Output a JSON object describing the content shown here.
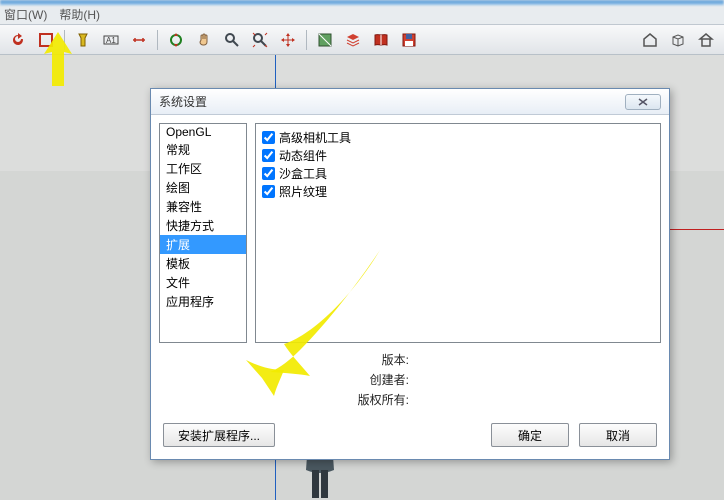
{
  "menubar": {
    "window": "窗口(W)",
    "help": "帮助(H)"
  },
  "dialog": {
    "title": "系统设置",
    "categories": [
      "OpenGL",
      "常规",
      "工作区",
      "绘图",
      "兼容性",
      "快捷方式",
      "扩展",
      "模板",
      "文件",
      "应用程序"
    ],
    "selected_index": 6,
    "extensions": [
      {
        "label": "高级相机工具",
        "checked": true
      },
      {
        "label": "动态组件",
        "checked": true
      },
      {
        "label": "沙盒工具",
        "checked": true
      },
      {
        "label": "照片纹理",
        "checked": true
      }
    ],
    "info_version_label": "版本:",
    "info_author_label": "创建者:",
    "info_copyright_label": "版权所有:",
    "install_btn": "安装扩展程序...",
    "ok_btn": "确定",
    "cancel_btn": "取消"
  }
}
